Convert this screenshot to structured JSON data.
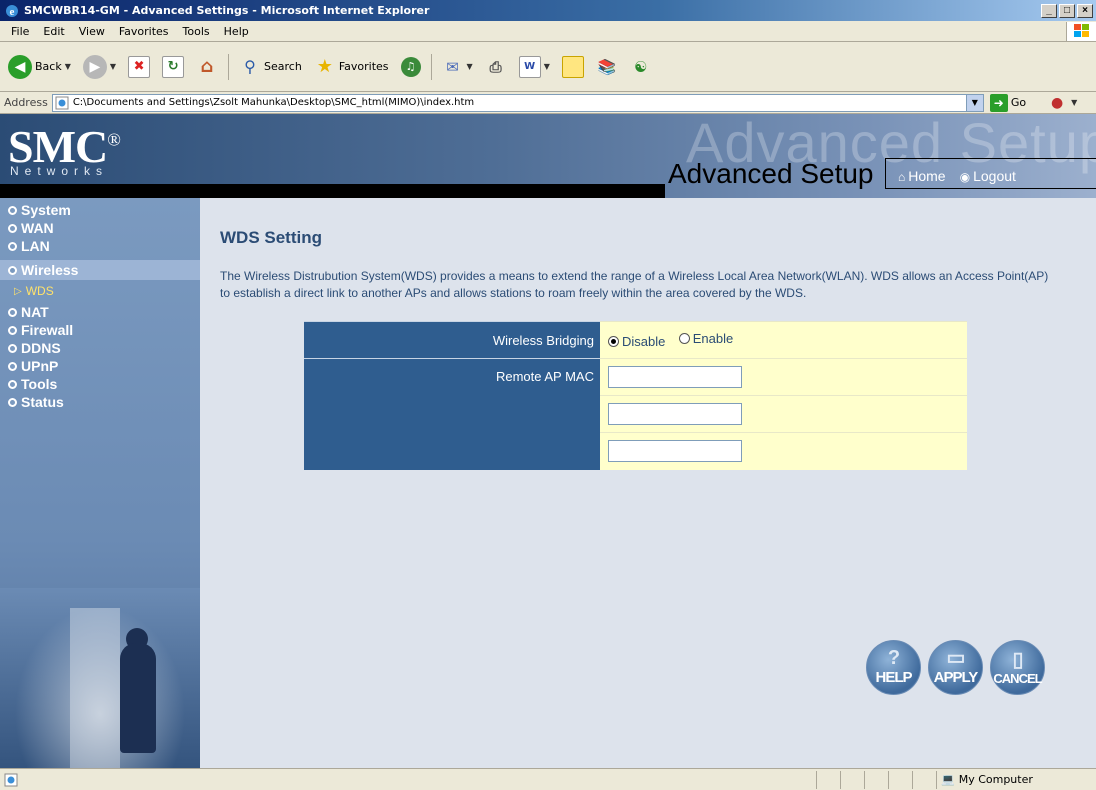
{
  "window": {
    "title": "SMCWBR14-GM - Advanced Settings - Microsoft Internet Explorer",
    "buttons": [
      "_",
      "□",
      "×"
    ]
  },
  "menubar": {
    "items": [
      "File",
      "Edit",
      "View",
      "Favorites",
      "Tools",
      "Help"
    ]
  },
  "toolbar": {
    "back_label": "Back",
    "search_label": "Search",
    "favorites_label": "Favorites"
  },
  "address": {
    "label": "Address",
    "url": "C:\\Documents and Settings\\Zsolt Mahunka\\Desktop\\SMC_html(MIMO)\\index.htm",
    "go_label": "Go"
  },
  "header": {
    "logo": "SMC",
    "logo_mark": "®",
    "networks": "Networks",
    "ghost_text": "Advanced Setup",
    "title": "Advanced Setup",
    "home_label": "Home",
    "logout_label": "Logout"
  },
  "sidebar": {
    "items": [
      {
        "label": "System"
      },
      {
        "label": "WAN"
      },
      {
        "label": "LAN"
      },
      {
        "label": "Wireless"
      },
      {
        "label": "WDS"
      },
      {
        "label": "NAT"
      },
      {
        "label": "Firewall"
      },
      {
        "label": "DDNS"
      },
      {
        "label": "UPnP"
      },
      {
        "label": "Tools"
      },
      {
        "label": "Status"
      }
    ]
  },
  "content": {
    "heading": "WDS Setting",
    "description": "The Wireless Distrubution System(WDS) provides a means to extend the range of a Wireless Local Area Network(WLAN). WDS allows an Access Point(AP) to establish a direct link to another APs and allows stations to roam freely within the area covered by the WDS.",
    "bridging_label": "Wireless Bridging",
    "disable_label": "Disable",
    "enable_label": "Enable",
    "bridging_selected": "Disable",
    "remote_mac_label": "Remote AP MAC",
    "mac_values": [
      "",
      "",
      ""
    ]
  },
  "actions": {
    "help_label": "HELP",
    "apply_label": "APPLY",
    "cancel_label": "CANCEL"
  },
  "statusbar": {
    "zone_label": "My Computer"
  }
}
